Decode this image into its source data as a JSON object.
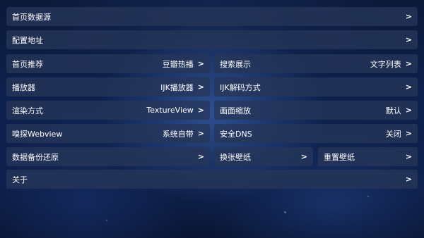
{
  "settings": {
    "home_source": {
      "label": "首页数据源",
      "arrow": ">"
    },
    "config_url": {
      "label": "配置地址",
      "arrow": ">"
    },
    "home_recommend": {
      "label": "首页推荐",
      "value": "豆瓣热播",
      "arrow": ">"
    },
    "search_display": {
      "label": "搜索展示",
      "value": "文字列表",
      "arrow": ">"
    },
    "player": {
      "label": "播放器",
      "value": "IJK播放器",
      "arrow": ">"
    },
    "ijk_decode": {
      "label": "IJK解码方式",
      "arrow": ">"
    },
    "render_mode": {
      "label": "渲染方式",
      "value": "TextureView",
      "arrow": ">"
    },
    "screen_scale": {
      "label": "画面缩放",
      "value": "默认",
      "arrow": ">"
    },
    "sniff_webview": {
      "label": "嗅探Webview",
      "value": "系统自带",
      "arrow": ">"
    },
    "secure_dns": {
      "label": "安全DNS",
      "value": "关闭",
      "arrow": ">"
    },
    "backup_restore": {
      "label": "数据备份还原",
      "arrow": ">"
    },
    "change_wallpaper": {
      "label": "换张壁纸",
      "arrow": ">"
    },
    "reset_wallpaper": {
      "label": "重置壁纸",
      "arrow": ">"
    },
    "about": {
      "label": "关于",
      "arrow": ">"
    }
  }
}
